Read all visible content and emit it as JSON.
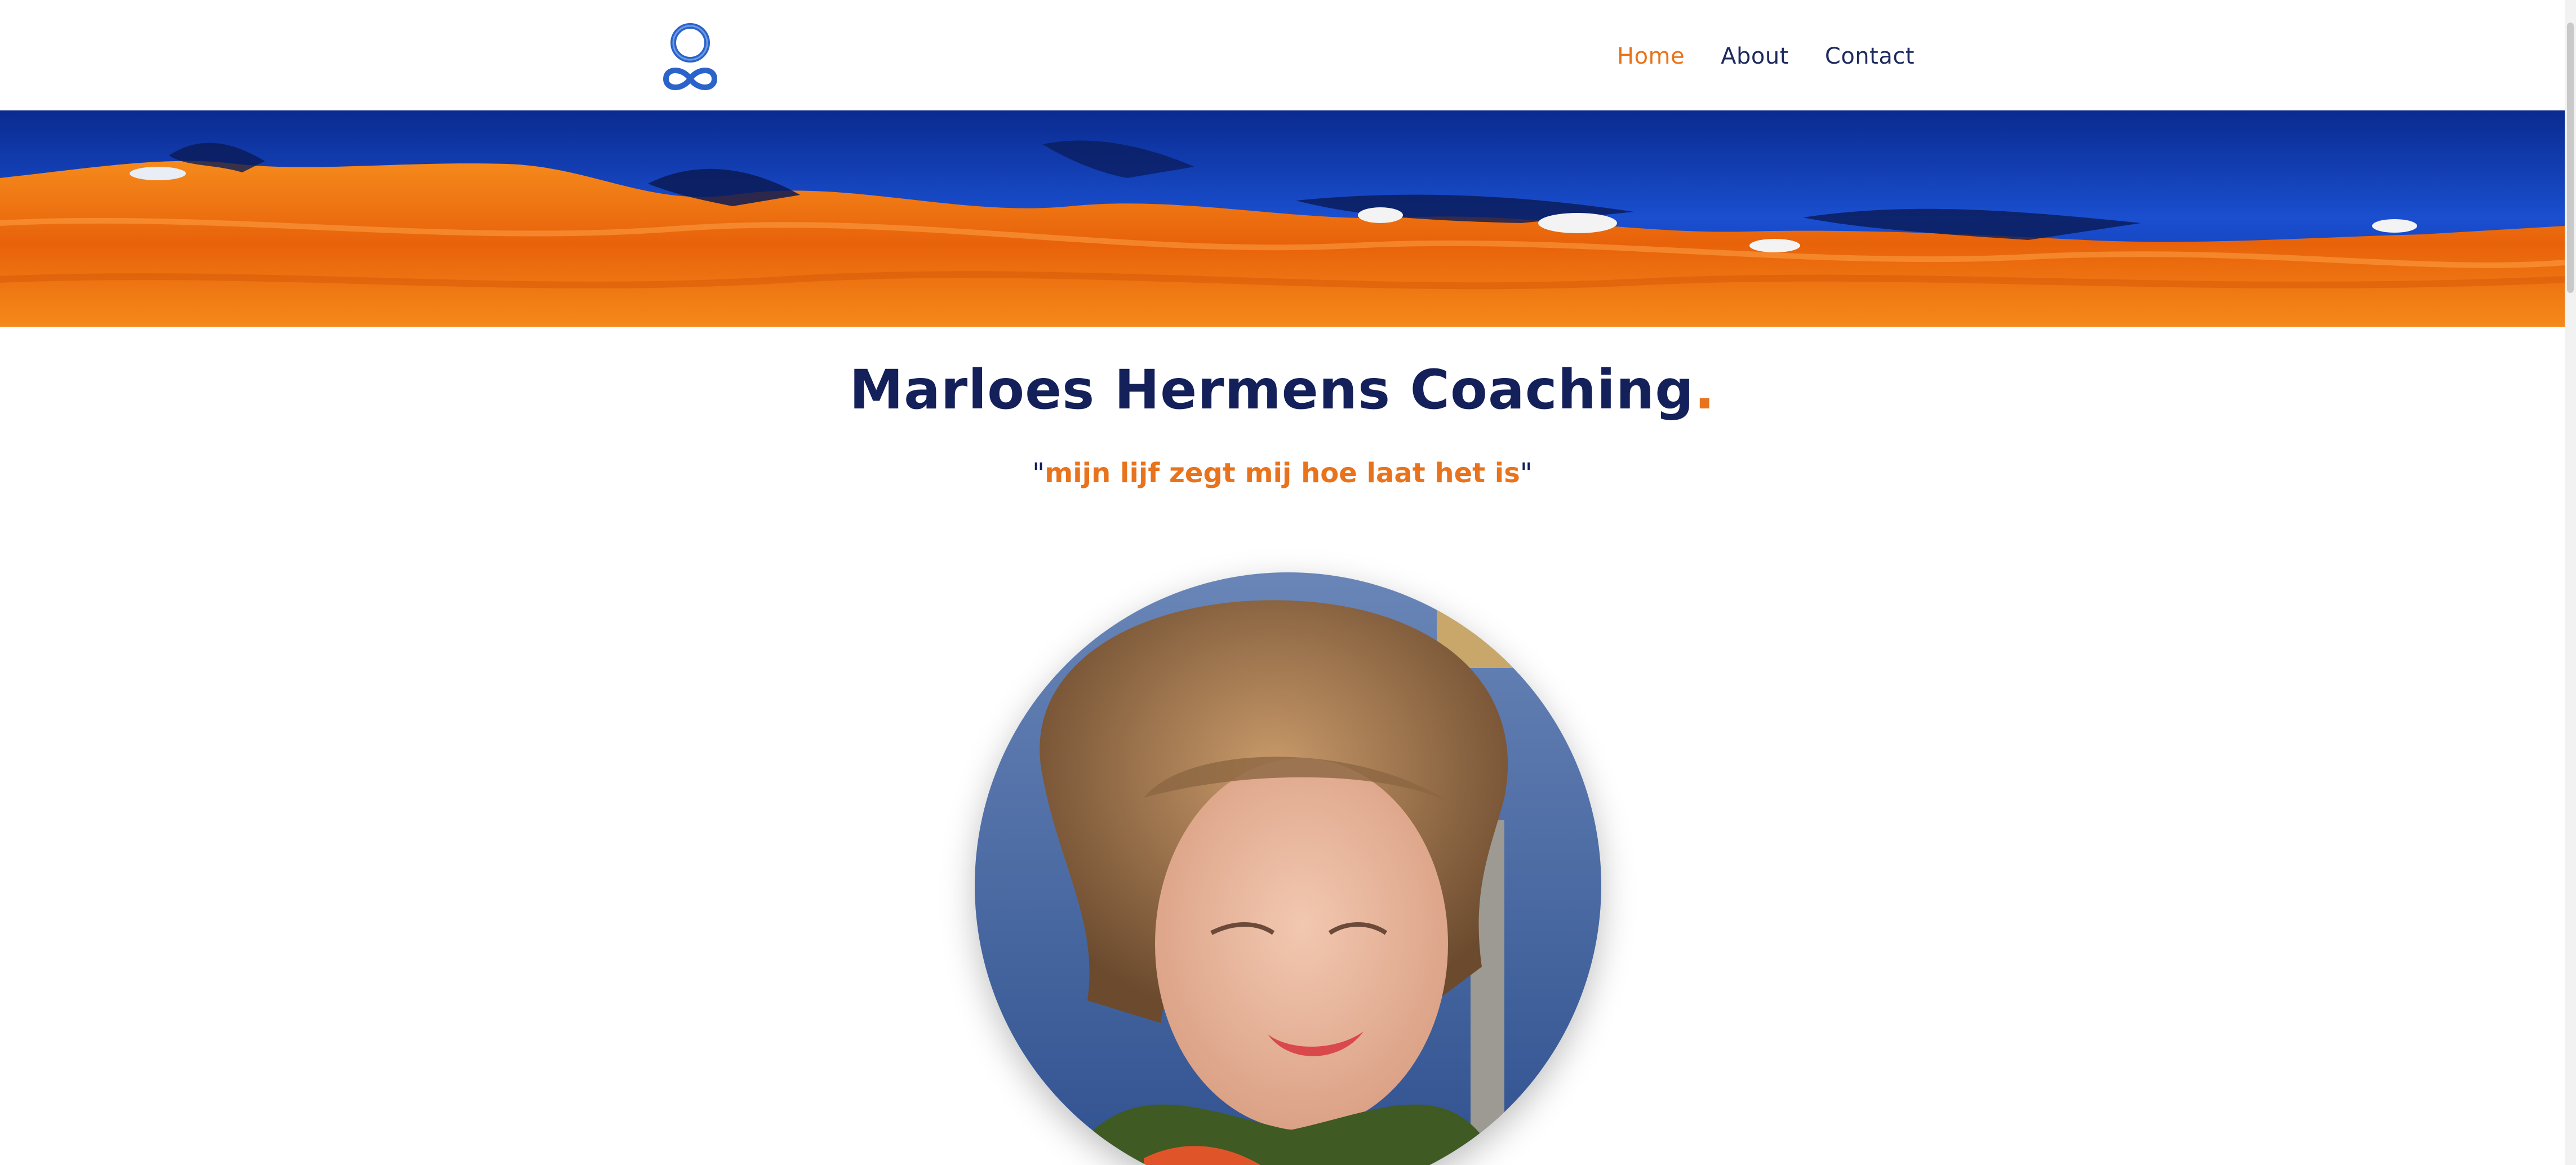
{
  "nav": {
    "items": [
      {
        "label": "Home",
        "active": true
      },
      {
        "label": "About",
        "active": false
      },
      {
        "label": "Contact",
        "active": false
      }
    ]
  },
  "hero": {
    "title": "Marloes Hermens Coaching",
    "title_dot": ".",
    "quote_open": "\"",
    "quote": "mijn lijf zegt mij hoe laat het is",
    "quote_close": "\""
  },
  "colors": {
    "navy": "#14205a",
    "orange": "#e8731c",
    "blue": "#1f4fbf"
  },
  "icons": {
    "logo": "infinity-circle-logo"
  }
}
